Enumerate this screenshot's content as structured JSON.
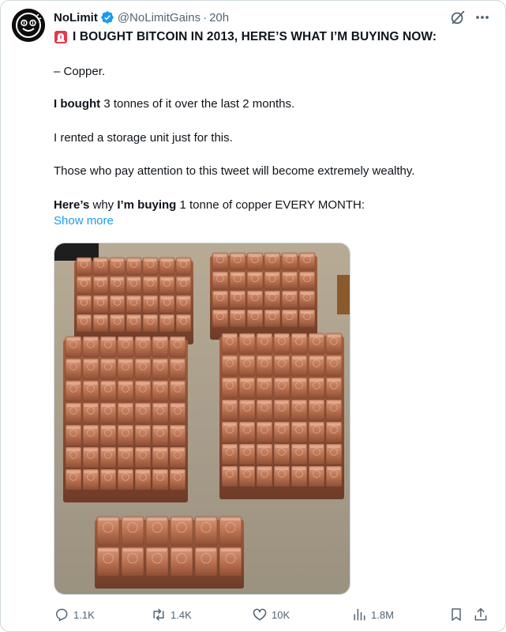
{
  "author": {
    "name": "NoLimit",
    "handle": "@NoLimitGains",
    "separator": "·",
    "time": "20h"
  },
  "tweet": {
    "headline": "I BOUGHT BITCOIN IN 2013, HERE’S WHAT I’M BUYING NOW:",
    "line1": "– Copper.",
    "line2_bold": "I bought",
    "line2_rest": " 3 tonnes of it over the last 2 months.",
    "line3": "I rented a storage unit just for this.",
    "line4": "Those who pay attention to this tweet will become extremely wealthy.",
    "line5_bold1": "Here’s",
    "line5_mid": " why ",
    "line5_bold2": "I’m buying",
    "line5_rest": " 1 tonne of copper EVERY MONTH:",
    "show_more": "Show more"
  },
  "actions": {
    "replies": "1.1K",
    "reposts": "1.4K",
    "likes": "10K",
    "views": "1.8M"
  },
  "icons": {
    "verified": "verified-badge-icon",
    "siren": "siren-emoji-icon",
    "grok": "grok-icon",
    "more": "more-icon",
    "reply": "reply-icon",
    "repost": "repost-icon",
    "like": "heart-icon",
    "views": "views-icon",
    "bookmark": "bookmark-icon",
    "share": "share-icon"
  },
  "colors": {
    "accent": "#1d9bf0",
    "muted": "#536471",
    "text": "#0f1419",
    "copper": "#b06a48"
  }
}
